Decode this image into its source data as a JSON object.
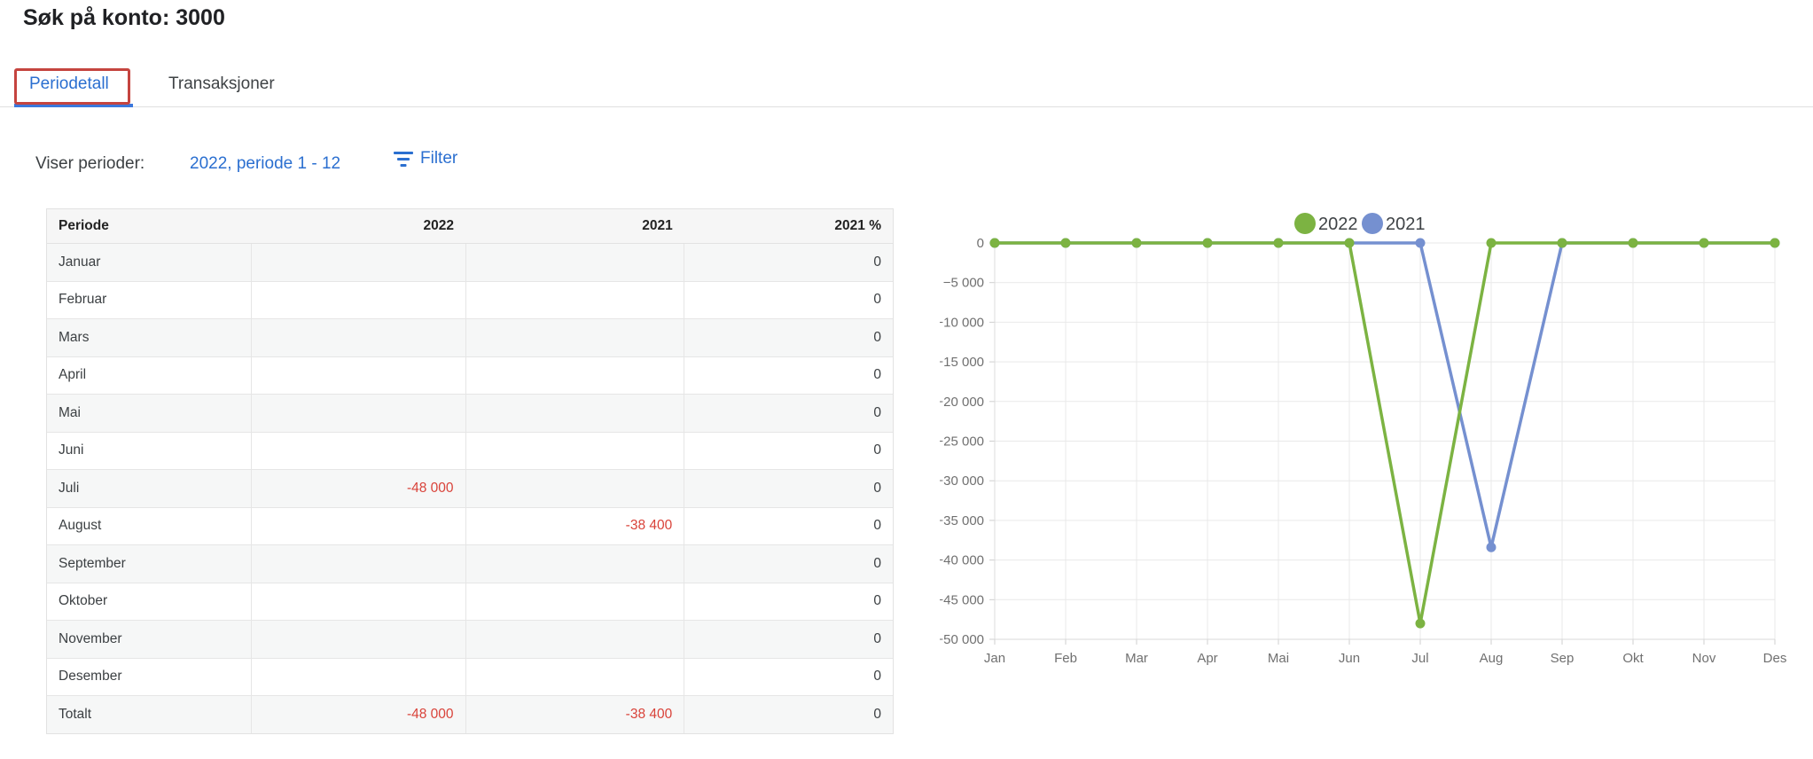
{
  "page": {
    "title": "Søk på konto: 3000"
  },
  "tabs": {
    "items": [
      {
        "label": "Periodetall",
        "active": true,
        "highlighted": true
      },
      {
        "label": "Transaksjoner",
        "active": false,
        "highlighted": false
      }
    ]
  },
  "period_bar": {
    "label": "Viser perioder:",
    "period_link": "2022, periode 1 - 12",
    "filter_button": "Filter",
    "filter_icon": "filter-list-icon"
  },
  "table": {
    "columns": [
      "Periode",
      "2022",
      "2021",
      "2021 %"
    ],
    "rows": [
      {
        "periode": "Januar",
        "y2022": "",
        "y2021": "",
        "pct2021": "0"
      },
      {
        "periode": "Februar",
        "y2022": "",
        "y2021": "",
        "pct2021": "0"
      },
      {
        "periode": "Mars",
        "y2022": "",
        "y2021": "",
        "pct2021": "0"
      },
      {
        "periode": "April",
        "y2022": "",
        "y2021": "",
        "pct2021": "0"
      },
      {
        "periode": "Mai",
        "y2022": "",
        "y2021": "",
        "pct2021": "0"
      },
      {
        "periode": "Juni",
        "y2022": "",
        "y2021": "",
        "pct2021": "0"
      },
      {
        "periode": "Juli",
        "y2022": "-48 000",
        "y2021": "",
        "pct2021": "0"
      },
      {
        "periode": "August",
        "y2022": "",
        "y2021": "-38 400",
        "pct2021": "0"
      },
      {
        "periode": "September",
        "y2022": "",
        "y2021": "",
        "pct2021": "0"
      },
      {
        "periode": "Oktober",
        "y2022": "",
        "y2021": "",
        "pct2021": "0"
      },
      {
        "periode": "November",
        "y2022": "",
        "y2021": "",
        "pct2021": "0"
      },
      {
        "periode": "Desember",
        "y2022": "",
        "y2021": "",
        "pct2021": "0"
      },
      {
        "periode": "Totalt",
        "y2022": "-48 000",
        "y2021": "-38 400",
        "pct2021": "0"
      }
    ]
  },
  "chart_data": {
    "type": "line",
    "categories": [
      "Jan",
      "Feb",
      "Mar",
      "Apr",
      "Mai",
      "Jun",
      "Jul",
      "Aug",
      "Sep",
      "Okt",
      "Nov",
      "Des"
    ],
    "series": [
      {
        "name": "2022",
        "color": "#7cb342",
        "values": [
          0,
          0,
          0,
          0,
          0,
          0,
          -48000,
          0,
          0,
          0,
          0,
          0
        ]
      },
      {
        "name": "2021",
        "color": "#7590d0",
        "values": [
          0,
          0,
          0,
          0,
          0,
          0,
          0,
          -38400,
          0,
          0,
          0,
          0
        ]
      }
    ],
    "title": "",
    "xlabel": "",
    "ylabel": "",
    "ylim": [
      -50000,
      0
    ],
    "ytick_step": 5000,
    "ytick_labels": [
      "0",
      "−5 000",
      "−10 000",
      "−15 000",
      "−20 000",
      "−25 000",
      "−30 000",
      "−35 000",
      "−40 000",
      "−45 000",
      "−50 000"
    ],
    "grid": true,
    "legend_position": "top-center",
    "legend": [
      "2022",
      "2021"
    ]
  },
  "colors": {
    "accent_blue": "#2b6fd0",
    "tab_underline_blue": "#3b78dc",
    "negative_red": "#d9433a",
    "highlight_box_red": "#c5443f",
    "series_green": "#7cb342",
    "series_blue": "#7590d0",
    "grid_gray": "#e9e9e9",
    "axis_label_gray": "#707070"
  }
}
